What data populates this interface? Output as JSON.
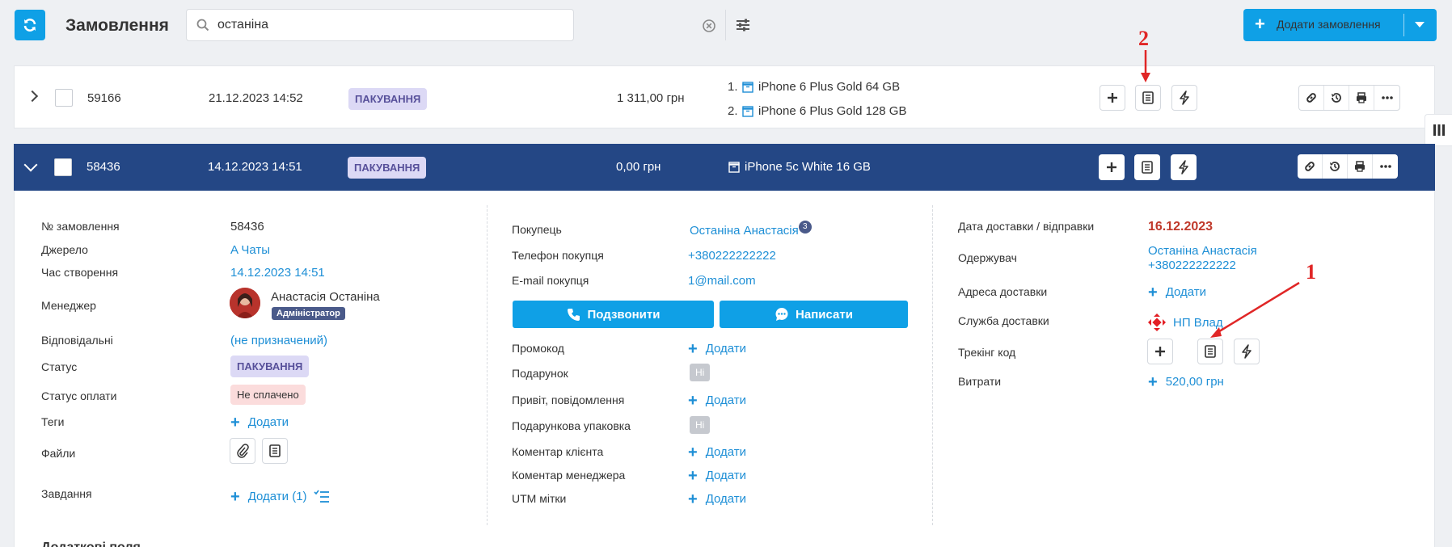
{
  "header": {
    "title": "Замовлення",
    "search_value": "останіна",
    "add_order_label": "Додати замовлення"
  },
  "orders": [
    {
      "id": "59166",
      "date": "21.12.2023 14:52",
      "status": "ПАКУВАННЯ",
      "sum": "1 311,00 грн",
      "products": [
        {
          "num": "1.",
          "name": "iPhone 6 Plus Gold 64 GB"
        },
        {
          "num": "2.",
          "name": "iPhone 6 Plus Gold 128 GB"
        }
      ]
    },
    {
      "id": "58436",
      "date": "14.12.2023 14:51",
      "status": "ПАКУВАННЯ",
      "sum": "0,00 грн",
      "products": [
        {
          "num": "",
          "name": "iPhone 5c White 16 GB"
        }
      ]
    }
  ],
  "details": {
    "col1": {
      "order_no_label": "№ замовлення",
      "order_no": "58436",
      "source_label": "Джерело",
      "source": "A Чаты",
      "created_label": "Час створення",
      "created": "14.12.2023 14:51",
      "manager_label": "Менеджер",
      "manager_name": "Анастасія Останіна",
      "manager_role": "Адміністратор",
      "responsible_label": "Відповідальні",
      "responsible": "(не призначений)",
      "status_label": "Статус",
      "status": "ПАКУВАННЯ",
      "payment_label": "Статус оплати",
      "payment": "Не сплачено",
      "tags_label": "Теги",
      "tags_add": "Додати",
      "files_label": "Файли",
      "tasks_label": "Завдання",
      "tasks_add": "Додати (1)"
    },
    "col2": {
      "buyer_label": "Покупець",
      "buyer": "Останіна Анастасія",
      "buyer_count": "3",
      "phone_label": "Телефон покупця",
      "phone": "+380222222222",
      "email_label": "E-mail покупця",
      "email": "1@mail.com",
      "call_btn": "Подзвонити",
      "write_btn": "Написати",
      "promo_label": "Промокод",
      "promo_add": "Додати",
      "gift_label": "Подарунок",
      "gift": "Ні",
      "greeting_label": "Привіт, повідомлення",
      "greeting_add": "Додати",
      "wrap_label": "Подарункова упаковка",
      "wrap": "Ні",
      "client_comment_label": "Коментар клієнта",
      "client_comment_add": "Додати",
      "manager_comment_label": "Коментар менеджера",
      "manager_comment_add": "Додати",
      "utm_label": "UTM мітки",
      "utm_add": "Додати"
    },
    "col3": {
      "delivery_date_label": "Дата доставки / відправки",
      "delivery_date": "16.12.2023",
      "recipient_label": "Одержувач",
      "recipient_name": "Останіна Анастасія",
      "recipient_phone": "+380222222222",
      "address_label": "Адреса доставки",
      "address_add": "Додати",
      "service_label": "Служба доставки",
      "service": "НП Влад",
      "tracking_label": "Трекінг код",
      "costs_label": "Витрати",
      "costs": "520,00 грн"
    },
    "more_fields_label": "Додаткові поля"
  },
  "annotations": {
    "one": "1",
    "two": "2"
  },
  "colors": {
    "accent": "#0fa0e6",
    "selected_row": "#244785",
    "link": "#1e8fd6",
    "annotation": "#e02626"
  }
}
